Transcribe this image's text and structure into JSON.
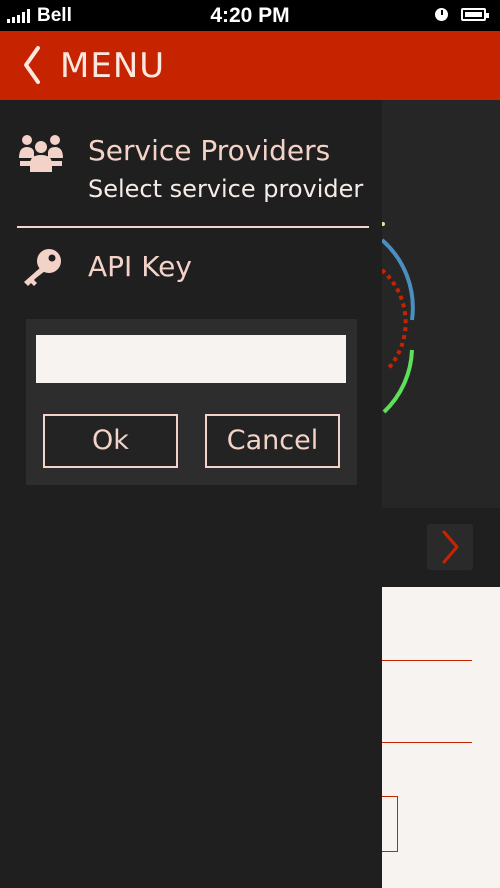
{
  "status_bar": {
    "carrier": "Bell",
    "time": "4:20 PM"
  },
  "header": {
    "back_icon": "chevron-left-icon",
    "title": "MENU"
  },
  "drawer": {
    "service_providers": {
      "icon": "people-group-icon",
      "title": "Service Providers",
      "subtitle": "Select service provider"
    },
    "api_key": {
      "icon": "key-icon",
      "title": "API Key"
    },
    "dialog": {
      "input_value": "",
      "ok_label": "Ok",
      "cancel_label": "Cancel"
    }
  },
  "background": {
    "next_icon": "chevron-right-icon"
  },
  "colors": {
    "accent": "#c62400",
    "drawer_bg": "#1f1f1f",
    "dialog_bg": "#2d2d2d",
    "text_light": "#f3d3c8",
    "arc_blue": "#4a8fc0",
    "arc_green": "#5fe05a",
    "arc_red": "#c62400"
  }
}
